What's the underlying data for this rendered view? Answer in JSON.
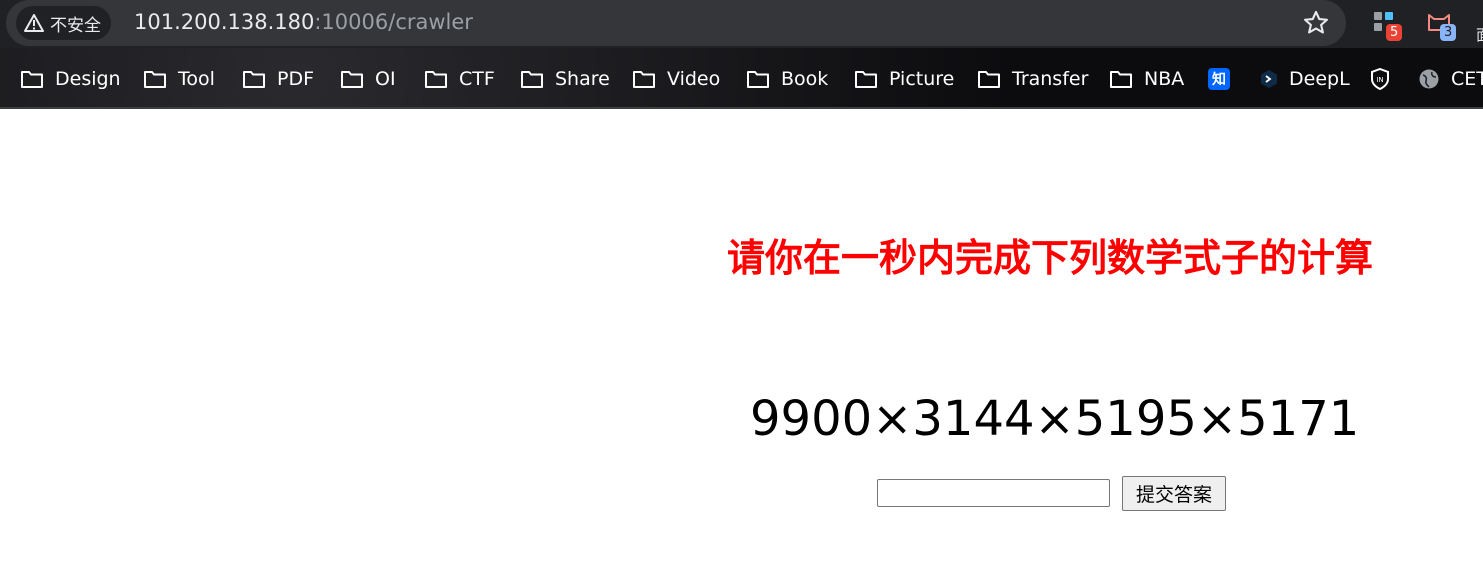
{
  "browser": {
    "security_label": "不安全",
    "url_host": "101.200.138.180",
    "url_rest": ":10006/crawler",
    "extensions": [
      {
        "name": "extension-1",
        "badge": "5",
        "color": "#ea4335"
      },
      {
        "name": "extension-2",
        "badge": "3",
        "color": "#8ab4f8"
      }
    ],
    "edge_glyph": "面"
  },
  "bookmarks": [
    {
      "label": "Design",
      "icon": "folder-icon"
    },
    {
      "label": "Tool",
      "icon": "folder-icon"
    },
    {
      "label": "PDF",
      "icon": "folder-icon"
    },
    {
      "label": "OI",
      "icon": "folder-icon"
    },
    {
      "label": "CTF",
      "icon": "folder-icon"
    },
    {
      "label": "Share",
      "icon": "folder-icon"
    },
    {
      "label": "Video",
      "icon": "folder-icon"
    },
    {
      "label": "Book",
      "icon": "folder-icon"
    },
    {
      "label": "Picture",
      "icon": "folder-icon"
    },
    {
      "label": "Transfer",
      "icon": "folder-icon"
    },
    {
      "label": "NBA",
      "icon": "folder-icon"
    },
    {
      "label": "",
      "icon": "zhihu-icon",
      "icon_text": "知"
    },
    {
      "label": "DeepL",
      "icon": "deepl-icon"
    },
    {
      "label": "",
      "icon": "shield-icon"
    },
    {
      "label": "CET",
      "icon": "globe-icon"
    }
  ],
  "page": {
    "title": "请你在一秒内完成下列数学式子的计算",
    "expression": "9900×3144×5195×5171",
    "answer_value": "",
    "submit_label": "提交答案"
  },
  "colors": {
    "title": "#ff0000",
    "chrome_bg": "#202124",
    "omnibox_bg": "#35363a"
  }
}
